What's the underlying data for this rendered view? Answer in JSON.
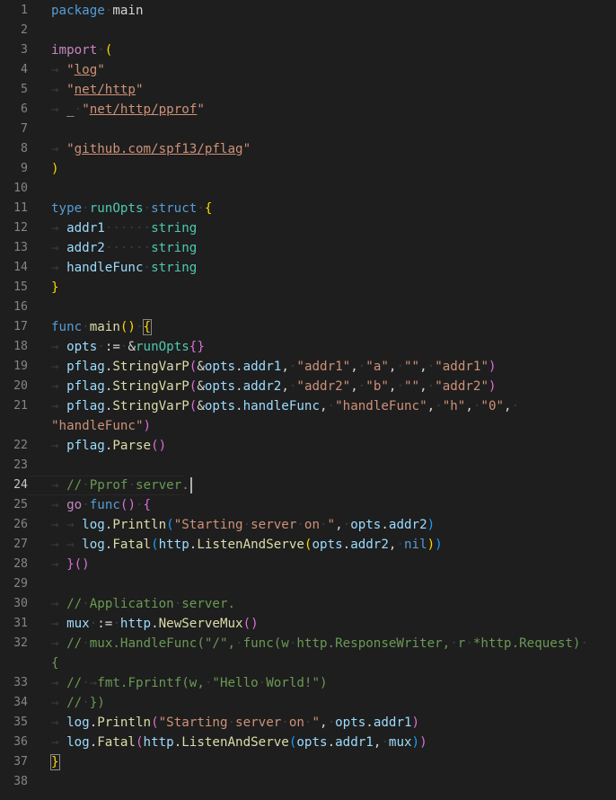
{
  "editor": {
    "language": "go",
    "current_line": 24,
    "lines": [
      {
        "n": "1",
        "tokens": [
          [
            "kw",
            "package"
          ],
          [
            "ws",
            "·"
          ],
          [
            "pun",
            "main"
          ]
        ]
      },
      {
        "n": "2",
        "tokens": []
      },
      {
        "n": "3",
        "tokens": [
          [
            "kw-ctrl",
            "import"
          ],
          [
            "ws",
            "·"
          ],
          [
            "b1",
            "("
          ]
        ]
      },
      {
        "n": "4",
        "tokens": [
          [
            "ws",
            "→ "
          ],
          [
            "str",
            "\""
          ],
          [
            "str ul",
            "log"
          ],
          [
            "str",
            "\""
          ]
        ]
      },
      {
        "n": "5",
        "tokens": [
          [
            "ws",
            "→ "
          ],
          [
            "str",
            "\""
          ],
          [
            "str ul",
            "net/http"
          ],
          [
            "str",
            "\""
          ]
        ]
      },
      {
        "n": "6",
        "tokens": [
          [
            "ws",
            "→ "
          ],
          [
            "pun",
            "_"
          ],
          [
            "ws",
            "·"
          ],
          [
            "str",
            "\""
          ],
          [
            "str ul",
            "net/http/pprof"
          ],
          [
            "str",
            "\""
          ]
        ]
      },
      {
        "n": "7",
        "tokens": []
      },
      {
        "n": "8",
        "tokens": [
          [
            "ws",
            "→ "
          ],
          [
            "str",
            "\""
          ],
          [
            "str ul",
            "github.com/spf13/pflag"
          ],
          [
            "str",
            "\""
          ]
        ]
      },
      {
        "n": "9",
        "tokens": [
          [
            "b1",
            ")"
          ]
        ]
      },
      {
        "n": "10",
        "tokens": []
      },
      {
        "n": "11",
        "tokens": [
          [
            "kw",
            "type"
          ],
          [
            "ws",
            "·"
          ],
          [
            "type",
            "runOpts"
          ],
          [
            "ws",
            "·"
          ],
          [
            "kw",
            "struct"
          ],
          [
            "ws",
            "·"
          ],
          [
            "b1",
            "{"
          ]
        ]
      },
      {
        "n": "12",
        "tokens": [
          [
            "ws",
            "→ "
          ],
          [
            "var",
            "addr1"
          ],
          [
            "ws",
            "······"
          ],
          [
            "type",
            "string"
          ]
        ]
      },
      {
        "n": "13",
        "tokens": [
          [
            "ws",
            "→ "
          ],
          [
            "var",
            "addr2"
          ],
          [
            "ws",
            "······"
          ],
          [
            "type",
            "string"
          ]
        ]
      },
      {
        "n": "14",
        "tokens": [
          [
            "ws",
            "→ "
          ],
          [
            "var",
            "handleFunc"
          ],
          [
            "ws",
            "·"
          ],
          [
            "type",
            "string"
          ]
        ]
      },
      {
        "n": "15",
        "tokens": [
          [
            "b1",
            "}"
          ]
        ]
      },
      {
        "n": "16",
        "tokens": []
      },
      {
        "n": "17",
        "tokens": [
          [
            "kw",
            "func"
          ],
          [
            "ws",
            "·"
          ],
          [
            "fn",
            "main"
          ],
          [
            "b1",
            "()"
          ],
          [
            "ws",
            "·"
          ],
          [
            "b1 bracket-match",
            "{"
          ]
        ]
      },
      {
        "n": "18",
        "tokens": [
          [
            "ws",
            "→ "
          ],
          [
            "var",
            "opts"
          ],
          [
            "ws",
            "·"
          ],
          [
            "pun",
            ":="
          ],
          [
            "ws",
            "·"
          ],
          [
            "pun",
            "&"
          ],
          [
            "type",
            "runOpts"
          ],
          [
            "b2",
            "{}"
          ]
        ]
      },
      {
        "n": "19",
        "tokens": [
          [
            "ws",
            "→ "
          ],
          [
            "var",
            "pflag"
          ],
          [
            "pun",
            "."
          ],
          [
            "fn",
            "StringVarP"
          ],
          [
            "b2",
            "("
          ],
          [
            "pun",
            "&"
          ],
          [
            "var",
            "opts"
          ],
          [
            "pun",
            "."
          ],
          [
            "var",
            "addr1"
          ],
          [
            "pun",
            ","
          ],
          [
            "ws",
            "·"
          ],
          [
            "str",
            "\"addr1\""
          ],
          [
            "pun",
            ","
          ],
          [
            "ws",
            "·"
          ],
          [
            "str",
            "\"a\""
          ],
          [
            "pun",
            ","
          ],
          [
            "ws",
            "·"
          ],
          [
            "str",
            "\"\""
          ],
          [
            "pun",
            ","
          ],
          [
            "ws",
            "·"
          ],
          [
            "str",
            "\"addr1\""
          ],
          [
            "b2",
            ")"
          ]
        ]
      },
      {
        "n": "20",
        "tokens": [
          [
            "ws",
            "→ "
          ],
          [
            "var",
            "pflag"
          ],
          [
            "pun",
            "."
          ],
          [
            "fn",
            "StringVarP"
          ],
          [
            "b2",
            "("
          ],
          [
            "pun",
            "&"
          ],
          [
            "var",
            "opts"
          ],
          [
            "pun",
            "."
          ],
          [
            "var",
            "addr2"
          ],
          [
            "pun",
            ","
          ],
          [
            "ws",
            "·"
          ],
          [
            "str",
            "\"addr2\""
          ],
          [
            "pun",
            ","
          ],
          [
            "ws",
            "·"
          ],
          [
            "str",
            "\"b\""
          ],
          [
            "pun",
            ","
          ],
          [
            "ws",
            "·"
          ],
          [
            "str",
            "\"\""
          ],
          [
            "pun",
            ","
          ],
          [
            "ws",
            "·"
          ],
          [
            "str",
            "\"addr2\""
          ],
          [
            "b2",
            ")"
          ]
        ]
      },
      {
        "n": "21",
        "tokens": [
          [
            "ws",
            "→ "
          ],
          [
            "var",
            "pflag"
          ],
          [
            "pun",
            "."
          ],
          [
            "fn",
            "StringVarP"
          ],
          [
            "b2",
            "("
          ],
          [
            "pun",
            "&"
          ],
          [
            "var",
            "opts"
          ],
          [
            "pun",
            "."
          ],
          [
            "var",
            "handleFunc"
          ],
          [
            "pun",
            ","
          ],
          [
            "ws",
            "·"
          ],
          [
            "str",
            "\"handleFunc\""
          ],
          [
            "pun",
            ","
          ],
          [
            "ws",
            "·"
          ],
          [
            "str",
            "\"h\""
          ],
          [
            "pun",
            ","
          ],
          [
            "ws",
            "·"
          ],
          [
            "str",
            "\"0\""
          ],
          [
            "pun",
            ","
          ],
          [
            "ws",
            "·"
          ]
        ]
      },
      {
        "n": "",
        "wrap": true,
        "tokens": [
          [
            "str",
            "\"handleFunc\""
          ],
          [
            "b2",
            ")"
          ]
        ]
      },
      {
        "n": "22",
        "tokens": [
          [
            "ws",
            "→ "
          ],
          [
            "var",
            "pflag"
          ],
          [
            "pun",
            "."
          ],
          [
            "fn",
            "Parse"
          ],
          [
            "b2",
            "()"
          ]
        ]
      },
      {
        "n": "23",
        "tokens": []
      },
      {
        "n": "24",
        "current": true,
        "tokens": [
          [
            "ws",
            "→ "
          ],
          [
            "com",
            "//"
          ],
          [
            "ws",
            "·"
          ],
          [
            "com",
            "Pprof"
          ],
          [
            "ws",
            "·"
          ],
          [
            "com",
            "server."
          ]
        ],
        "cursor": true
      },
      {
        "n": "25",
        "tokens": [
          [
            "ws",
            "→ "
          ],
          [
            "kw-ctrl",
            "go"
          ],
          [
            "ws",
            "·"
          ],
          [
            "kw",
            "func"
          ],
          [
            "b2",
            "()"
          ],
          [
            "ws",
            "·"
          ],
          [
            "b2",
            "{"
          ]
        ]
      },
      {
        "n": "26",
        "tokens": [
          [
            "ws",
            "→ → "
          ],
          [
            "var",
            "log"
          ],
          [
            "pun",
            "."
          ],
          [
            "fn",
            "Println"
          ],
          [
            "b3",
            "("
          ],
          [
            "str",
            "\"Starting"
          ],
          [
            "ws",
            "·"
          ],
          [
            "str",
            "server"
          ],
          [
            "ws",
            "·"
          ],
          [
            "str",
            "on"
          ],
          [
            "ws",
            "·"
          ],
          [
            "str",
            "\""
          ],
          [
            "pun",
            ","
          ],
          [
            "ws",
            "·"
          ],
          [
            "var",
            "opts"
          ],
          [
            "pun",
            "."
          ],
          [
            "var",
            "addr2"
          ],
          [
            "b3",
            ")"
          ]
        ]
      },
      {
        "n": "27",
        "tokens": [
          [
            "ws",
            "→ → "
          ],
          [
            "var",
            "log"
          ],
          [
            "pun",
            "."
          ],
          [
            "fn",
            "Fatal"
          ],
          [
            "b3",
            "("
          ],
          [
            "var",
            "http"
          ],
          [
            "pun",
            "."
          ],
          [
            "fn",
            "ListenAndServe"
          ],
          [
            "b1",
            "("
          ],
          [
            "var",
            "opts"
          ],
          [
            "pun",
            "."
          ],
          [
            "var",
            "addr2"
          ],
          [
            "pun",
            ","
          ],
          [
            "ws",
            "·"
          ],
          [
            "kw",
            "nil"
          ],
          [
            "b1",
            ")"
          ],
          [
            "b3",
            ")"
          ]
        ]
      },
      {
        "n": "28",
        "tokens": [
          [
            "ws",
            "→ "
          ],
          [
            "b2",
            "}()"
          ]
        ]
      },
      {
        "n": "29",
        "tokens": []
      },
      {
        "n": "30",
        "tokens": [
          [
            "ws",
            "→ "
          ],
          [
            "com",
            "//"
          ],
          [
            "ws",
            "·"
          ],
          [
            "com",
            "Application"
          ],
          [
            "ws",
            "·"
          ],
          [
            "com",
            "server."
          ]
        ]
      },
      {
        "n": "31",
        "tokens": [
          [
            "ws",
            "→ "
          ],
          [
            "var",
            "mux"
          ],
          [
            "ws",
            "·"
          ],
          [
            "pun",
            ":="
          ],
          [
            "ws",
            "·"
          ],
          [
            "var",
            "http"
          ],
          [
            "pun",
            "."
          ],
          [
            "fn",
            "NewServeMux"
          ],
          [
            "b2",
            "()"
          ]
        ]
      },
      {
        "n": "32",
        "tokens": [
          [
            "ws",
            "→ "
          ],
          [
            "com",
            "//"
          ],
          [
            "ws",
            "·"
          ],
          [
            "com",
            "mux.HandleFunc(\"/\","
          ],
          [
            "ws",
            "·"
          ],
          [
            "com",
            "func(w"
          ],
          [
            "ws",
            "·"
          ],
          [
            "com",
            "http.ResponseWriter,"
          ],
          [
            "ws",
            "·"
          ],
          [
            "com",
            "r"
          ],
          [
            "ws",
            "·"
          ],
          [
            "com",
            "*http.Request)"
          ],
          [
            "ws",
            "·"
          ]
        ]
      },
      {
        "n": "",
        "wrap": true,
        "tokens": [
          [
            "com",
            "{"
          ]
        ]
      },
      {
        "n": "33",
        "tokens": [
          [
            "ws",
            "→ "
          ],
          [
            "com",
            "//"
          ],
          [
            "ws",
            "·→"
          ],
          [
            "com",
            "fmt.Fprintf(w,"
          ],
          [
            "ws",
            "·"
          ],
          [
            "com",
            "\"Hello"
          ],
          [
            "ws",
            "·"
          ],
          [
            "com",
            "World!\")"
          ]
        ]
      },
      {
        "n": "34",
        "tokens": [
          [
            "ws",
            "→ "
          ],
          [
            "com",
            "//"
          ],
          [
            "ws",
            "·"
          ],
          [
            "com",
            "})"
          ]
        ]
      },
      {
        "n": "35",
        "tokens": [
          [
            "ws",
            "→ "
          ],
          [
            "var",
            "log"
          ],
          [
            "pun",
            "."
          ],
          [
            "fn",
            "Println"
          ],
          [
            "b2",
            "("
          ],
          [
            "str",
            "\"Starting"
          ],
          [
            "ws",
            "·"
          ],
          [
            "str",
            "server"
          ],
          [
            "ws",
            "·"
          ],
          [
            "str",
            "on"
          ],
          [
            "ws",
            "·"
          ],
          [
            "str",
            "\""
          ],
          [
            "pun",
            ","
          ],
          [
            "ws",
            "·"
          ],
          [
            "var",
            "opts"
          ],
          [
            "pun",
            "."
          ],
          [
            "var",
            "addr1"
          ],
          [
            "b2",
            ")"
          ]
        ]
      },
      {
        "n": "36",
        "tokens": [
          [
            "ws",
            "→ "
          ],
          [
            "var",
            "log"
          ],
          [
            "pun",
            "."
          ],
          [
            "fn",
            "Fatal"
          ],
          [
            "b2",
            "("
          ],
          [
            "var",
            "http"
          ],
          [
            "pun",
            "."
          ],
          [
            "fn",
            "ListenAndServe"
          ],
          [
            "b3",
            "("
          ],
          [
            "var",
            "opts"
          ],
          [
            "pun",
            "."
          ],
          [
            "var",
            "addr1"
          ],
          [
            "pun",
            ","
          ],
          [
            "ws",
            "·"
          ],
          [
            "var",
            "mux"
          ],
          [
            "b3",
            ")"
          ],
          [
            "b2",
            ")"
          ]
        ]
      },
      {
        "n": "37",
        "tokens": [
          [
            "b1 bracket-match",
            "}"
          ]
        ]
      },
      {
        "n": "38",
        "tokens": []
      }
    ]
  }
}
